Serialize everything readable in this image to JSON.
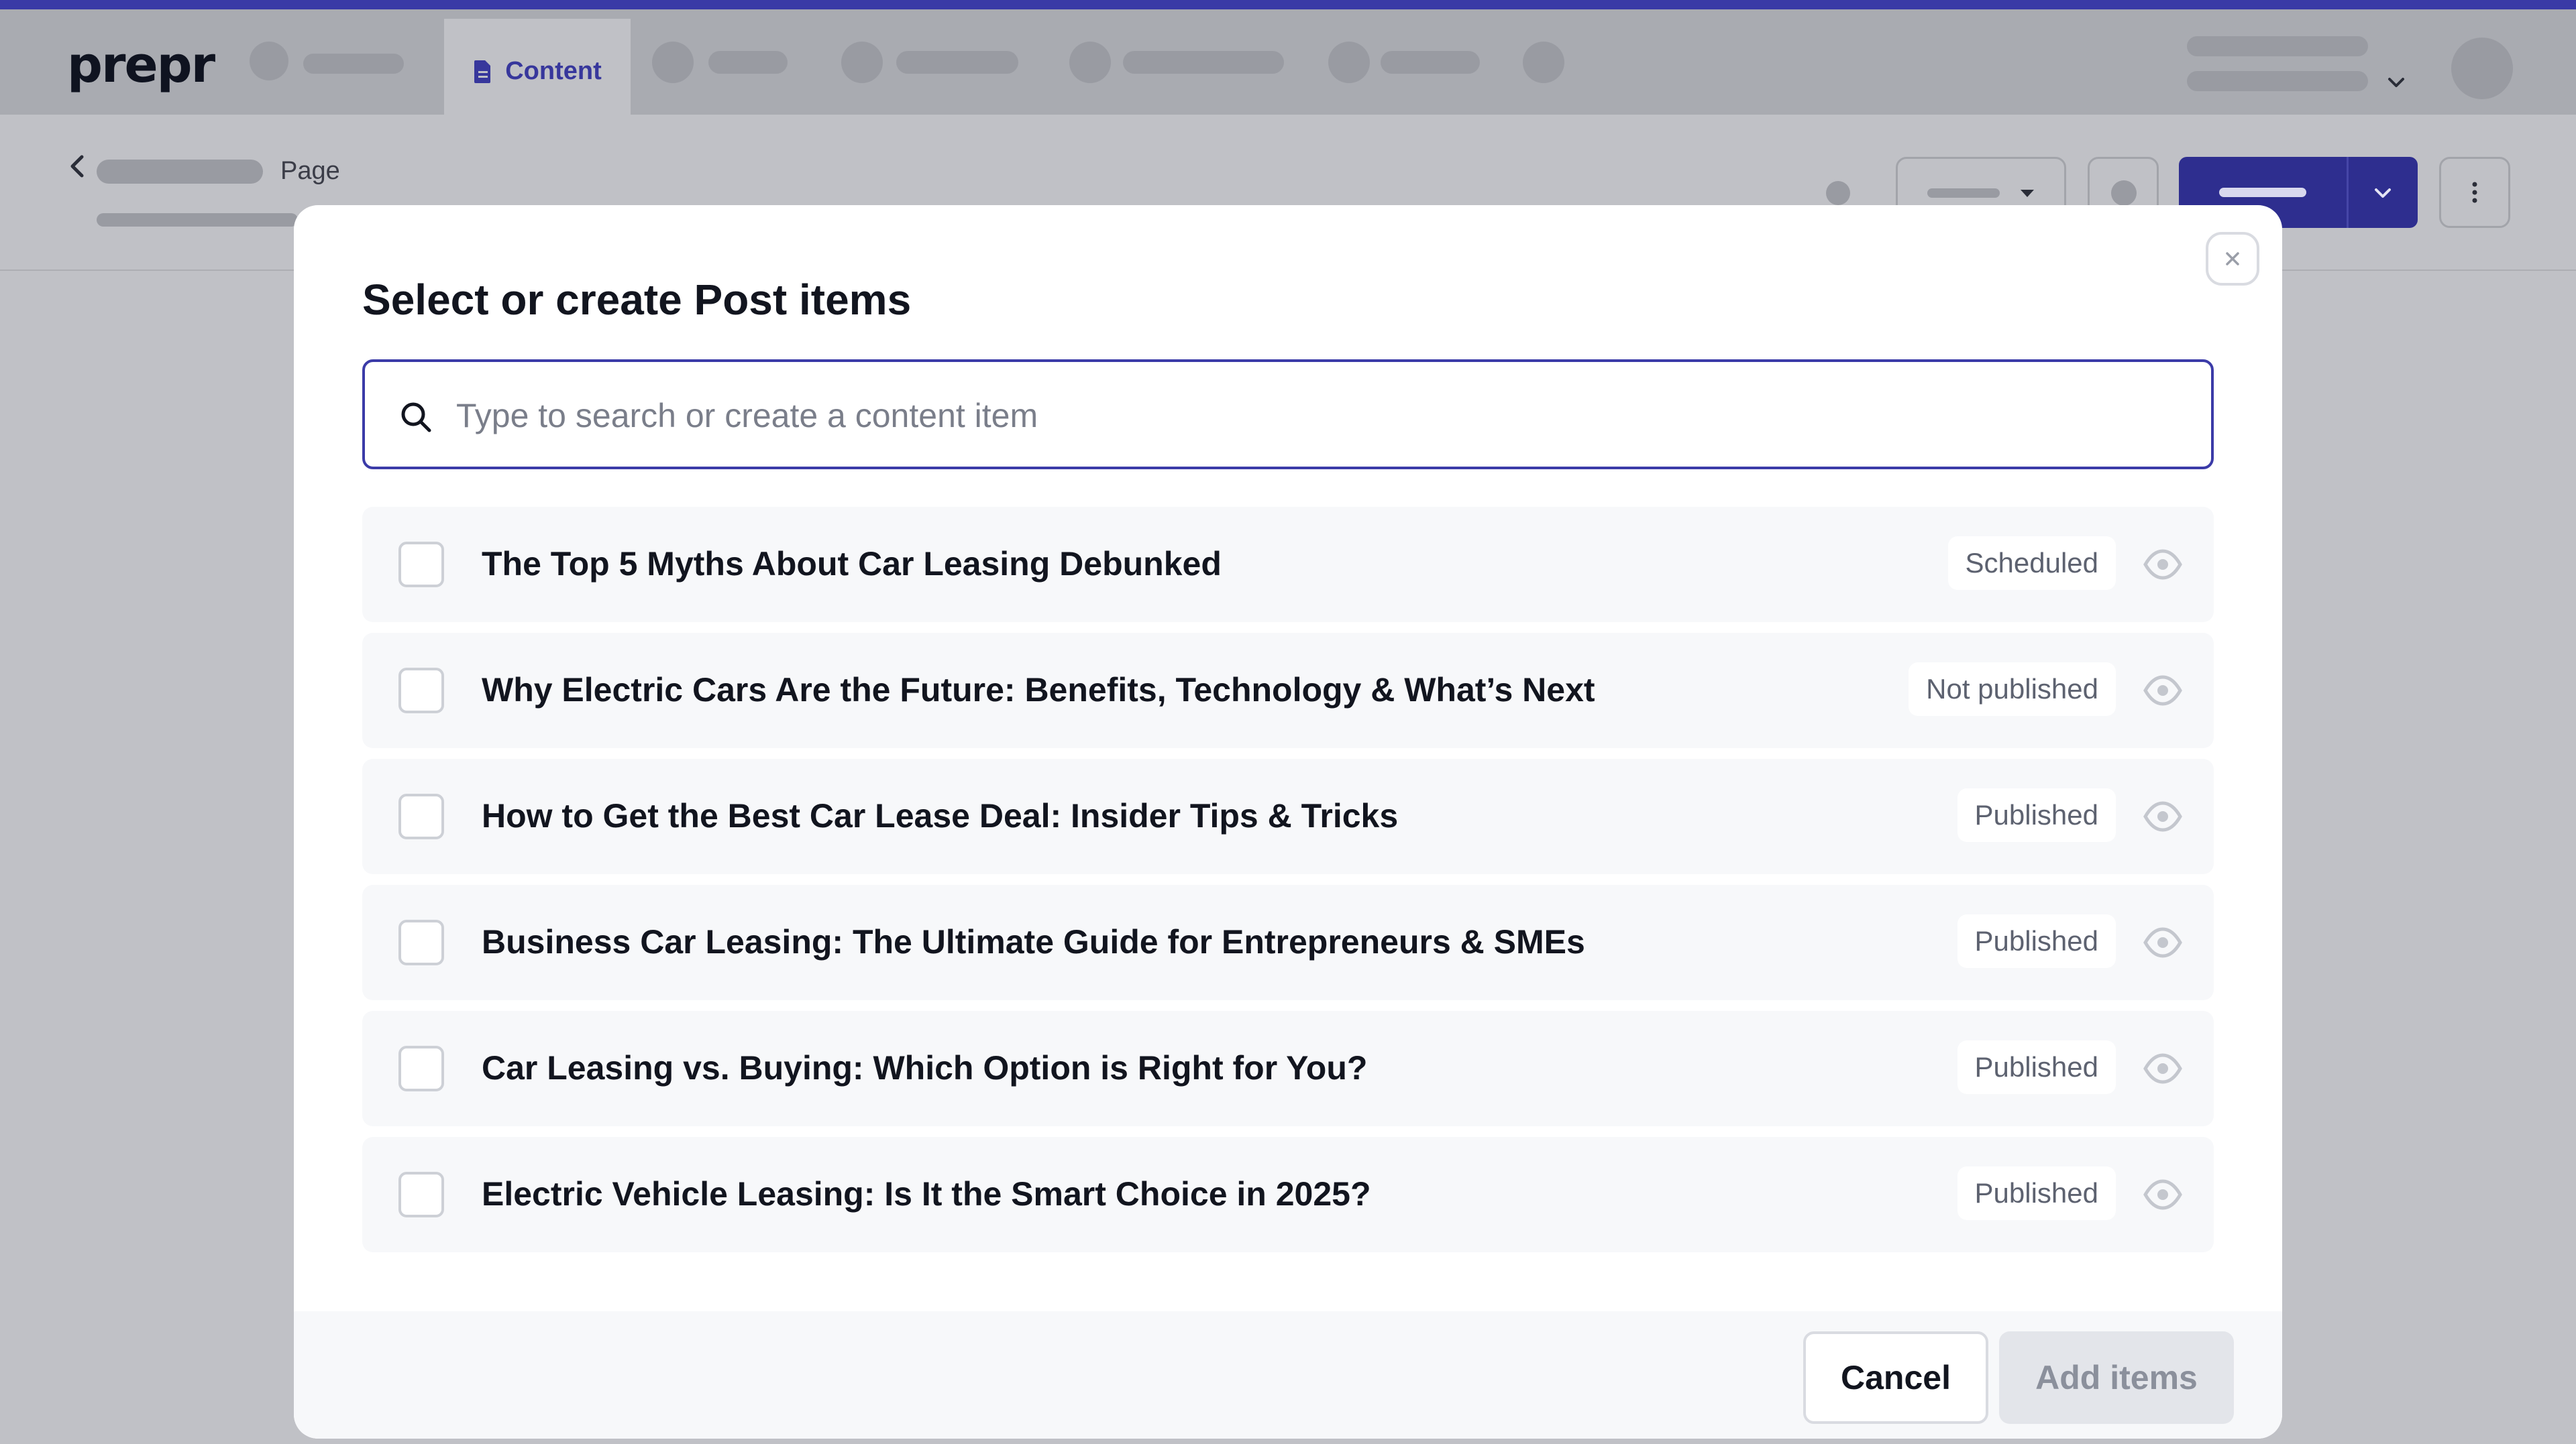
{
  "app": {
    "logo": "prepr"
  },
  "topnav": {
    "active_tab": "Content"
  },
  "subheader": {
    "breadcrumb_label": "Page"
  },
  "modal": {
    "title": "Select or create Post items",
    "search": {
      "placeholder": "Type to search or create a content item",
      "value": ""
    },
    "items": [
      {
        "title": "The Top 5 Myths About Car Leasing Debunked",
        "status": "Scheduled"
      },
      {
        "title": "Why Electric Cars Are the Future: Benefits, Technology & What’s Next",
        "status": "Not published"
      },
      {
        "title": "How to Get the Best Car Lease Deal: Insider Tips & Tricks",
        "status": "Published"
      },
      {
        "title": "Business Car Leasing: The Ultimate Guide for Entrepreneurs & SMEs",
        "status": "Published"
      },
      {
        "title": "Car Leasing vs. Buying: Which Option is Right for You?",
        "status": "Published"
      },
      {
        "title": "Electric Vehicle Leasing: Is It the Smart Choice in 2025?",
        "status": "Published"
      }
    ],
    "cancel_label": "Cancel",
    "add_label": "Add items"
  },
  "colors": {
    "accent": "#3b3ba8",
    "brand_bar": "#3a3aa6"
  },
  "icons": [
    "doc-icon",
    "back-chevron-icon",
    "close-icon",
    "search-icon",
    "eye-icon",
    "chevron-down-icon",
    "more-vertical-icon"
  ]
}
